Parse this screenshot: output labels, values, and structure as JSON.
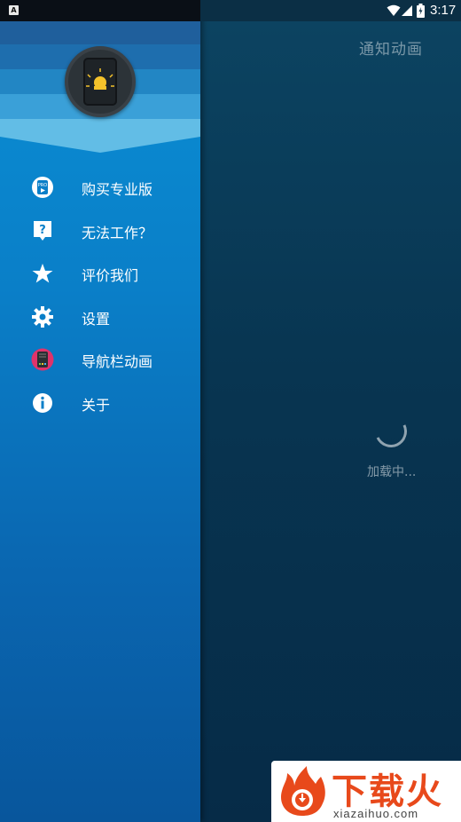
{
  "status_bar": {
    "notification_icon": "a-icon",
    "notification_glyph": "A",
    "time": "3:17",
    "icons": [
      "wifi-icon",
      "signal-icon",
      "battery-icon"
    ]
  },
  "main": {
    "title": "通知动画",
    "loading_text": "加载中..."
  },
  "drawer": {
    "header_icon": "bell-phone-app-icon",
    "items": [
      {
        "icon": "pro-badge-icon",
        "label": "购买专业版"
      },
      {
        "icon": "help-icon",
        "label": "无法工作？"
      },
      {
        "icon": "star-icon",
        "label": "评价我们"
      },
      {
        "icon": "gear-icon",
        "label": "设置"
      },
      {
        "icon": "navbar-app-icon",
        "label": "导航栏动画"
      },
      {
        "icon": "info-icon",
        "label": "关于"
      }
    ]
  },
  "watermark": {
    "brand": "下载火",
    "domain": "xiazaihuo.com",
    "accent": "#e8491b"
  },
  "colors": {
    "drawer_top": "#0b8fd4",
    "drawer_bottom": "#08569c",
    "main_bg": "#083551"
  }
}
